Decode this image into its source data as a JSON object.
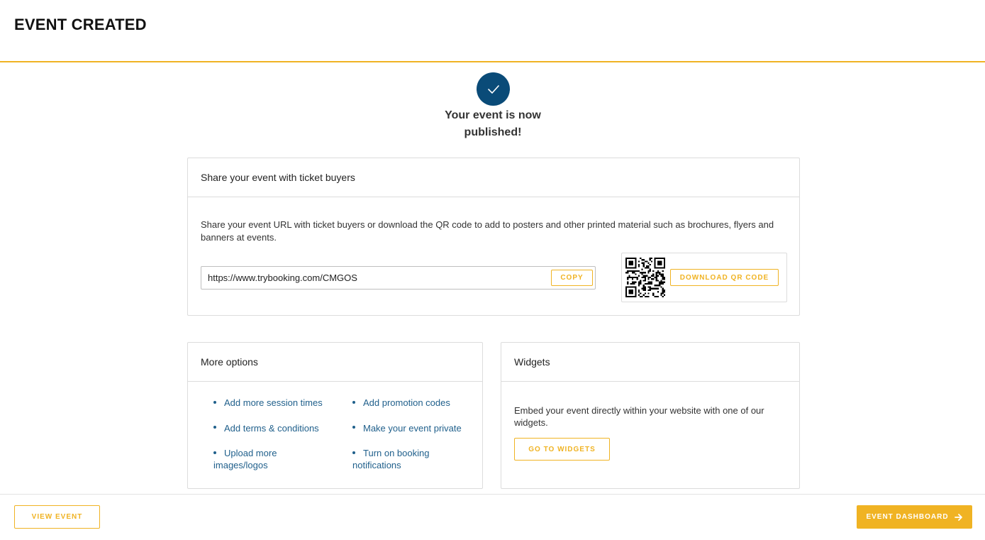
{
  "header": {
    "title": "EVENT CREATED"
  },
  "success": {
    "message": "Your event is now published!",
    "icon": "check-icon"
  },
  "share_card": {
    "title": "Share your event with ticket buyers",
    "description": "Share your event URL with ticket buyers or download the QR code to add to posters and other printed material such as brochures, flyers and banners at events.",
    "url": "https://www.trybooking.com/CMGOS",
    "copy_label": "COPY",
    "download_qr_label": "DOWNLOAD QR CODE"
  },
  "options_card": {
    "title": "More options",
    "items": [
      {
        "label": "Add more session times"
      },
      {
        "label": "Add promotion codes"
      },
      {
        "label": "Add terms & conditions"
      },
      {
        "label": "Make your event private"
      },
      {
        "label": "Upload more images/logos"
      },
      {
        "label": "Turn on booking notifications"
      }
    ]
  },
  "widgets_card": {
    "title": "Widgets",
    "description": "Embed your event directly within your website with one of our widgets.",
    "button_label": "GO TO WIDGETS"
  },
  "footer": {
    "view_event_label": "VIEW EVENT",
    "dashboard_label": "EVENT DASHBOARD"
  },
  "colors": {
    "accent": "#f0b323",
    "primary": "#0a4b78",
    "link": "#1f5f8b"
  }
}
